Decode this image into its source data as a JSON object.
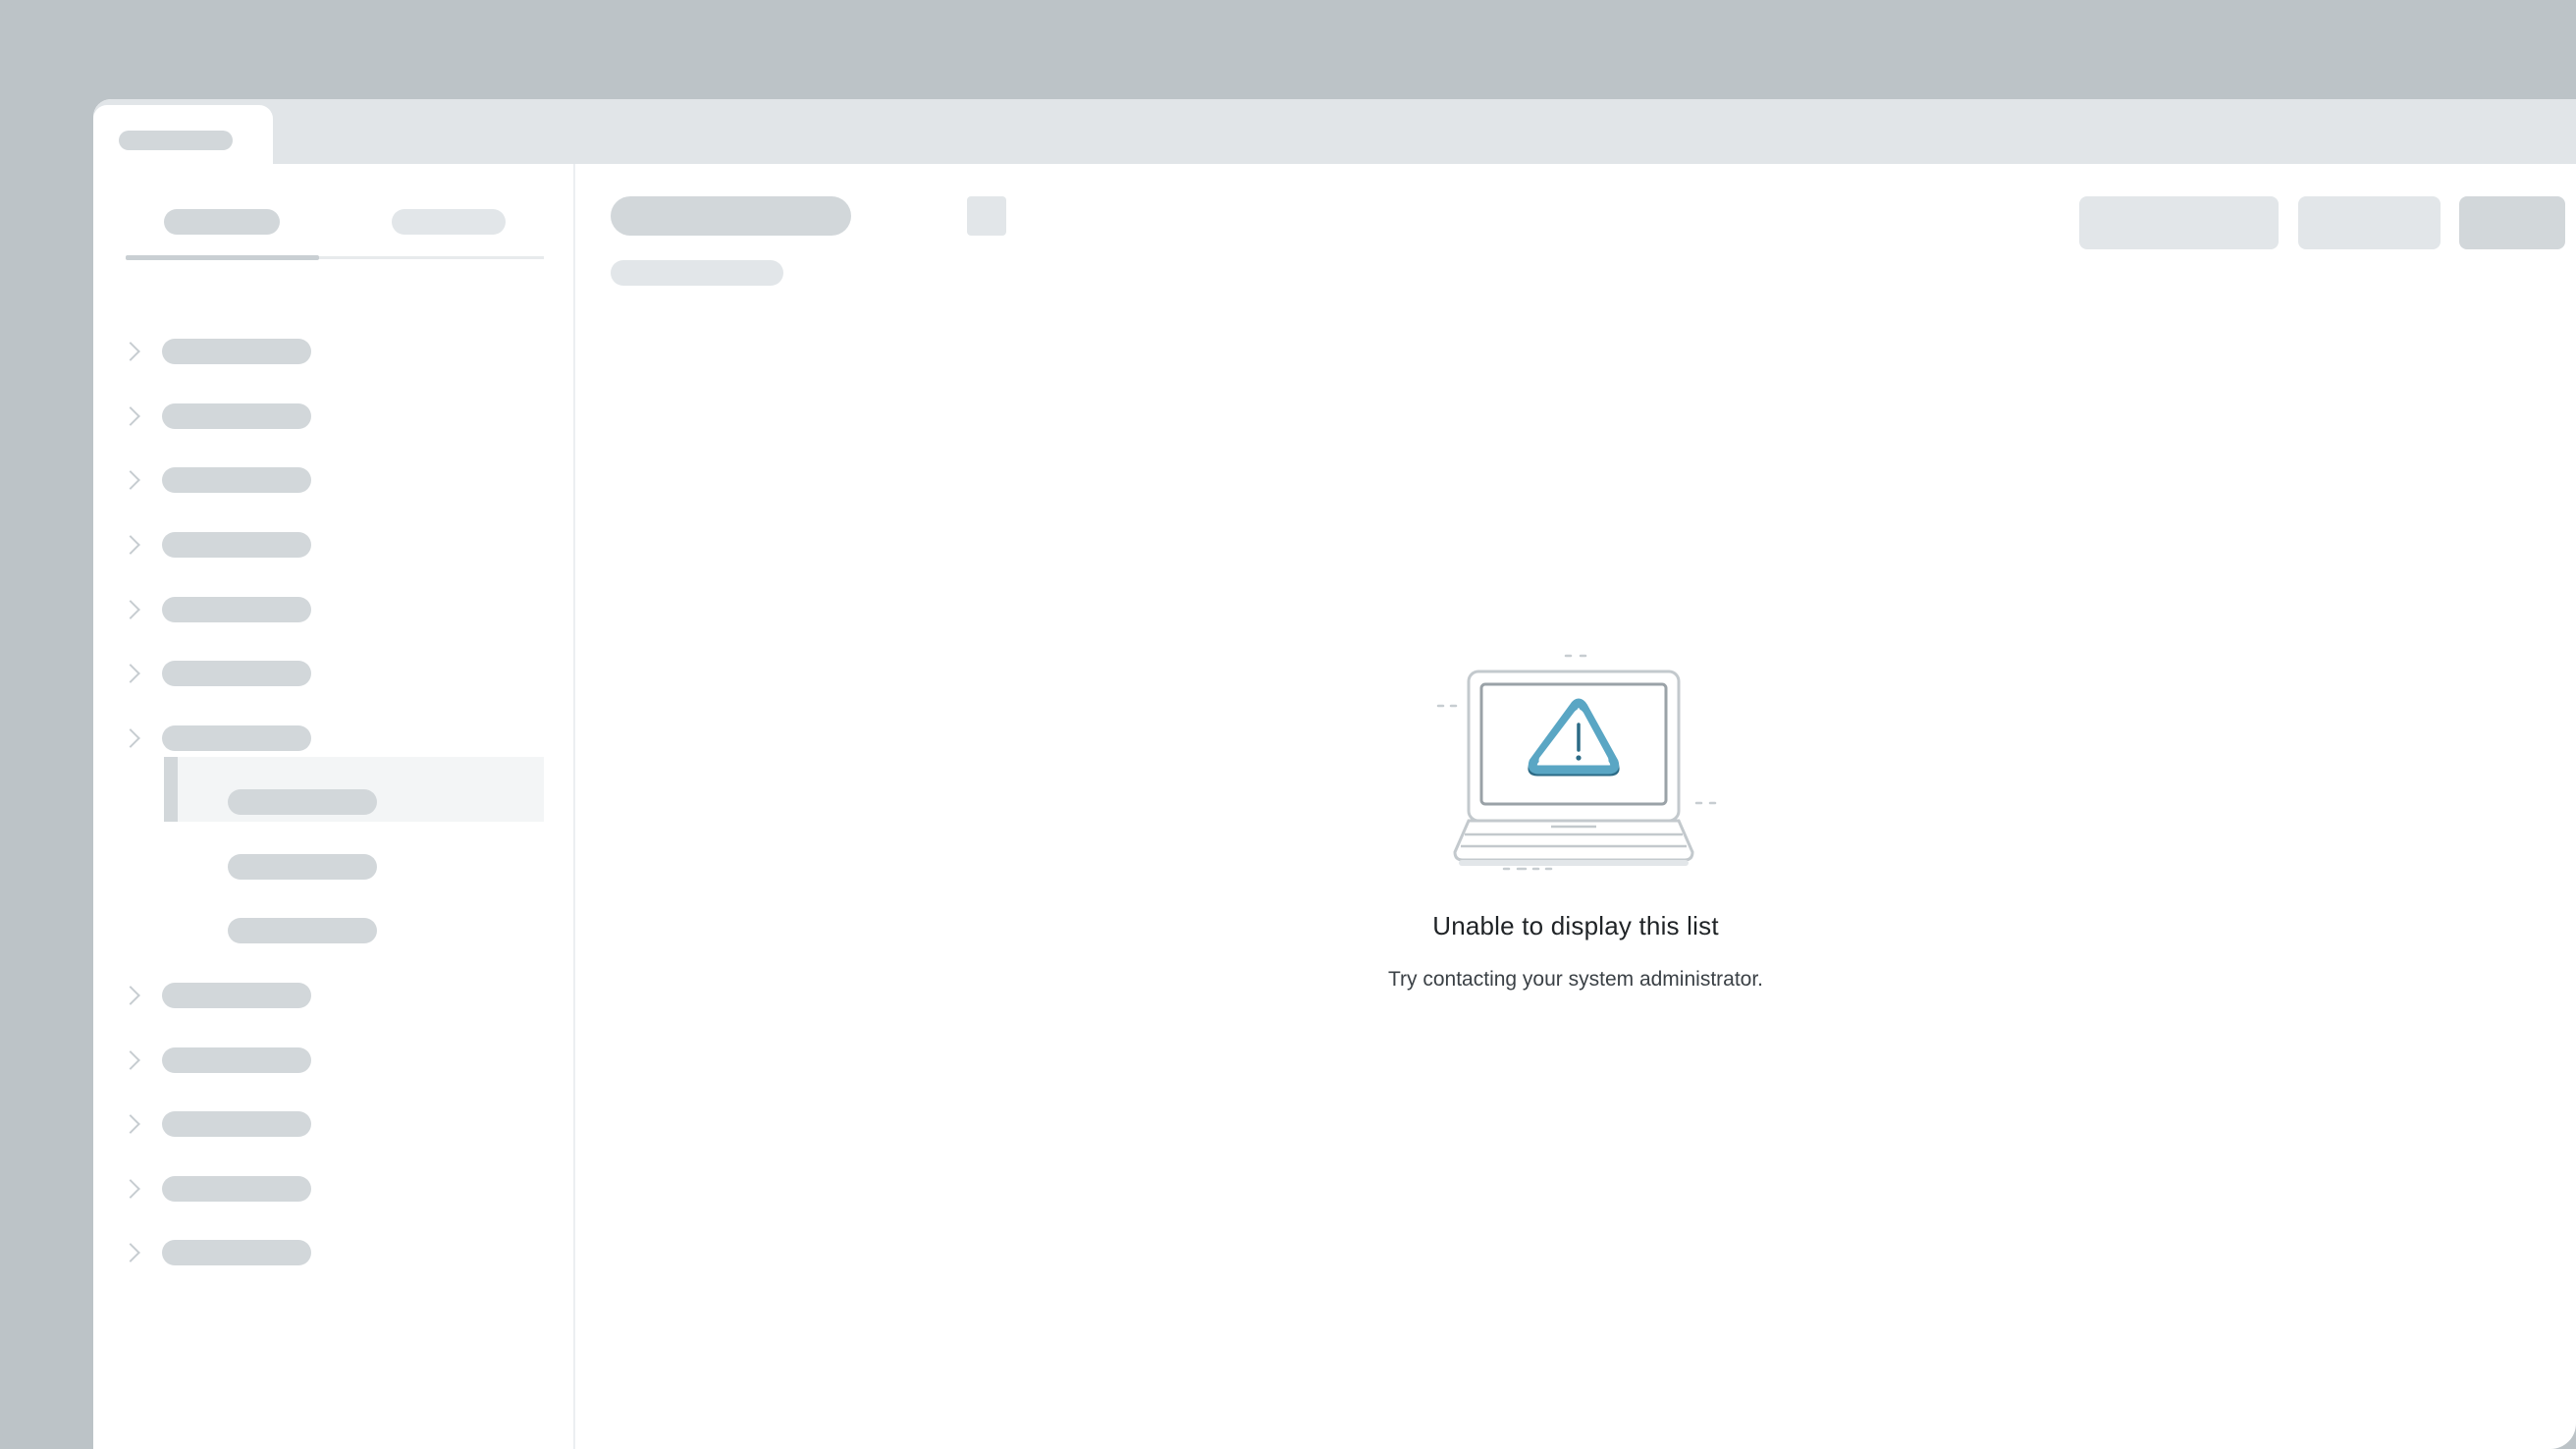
{
  "empty_state": {
    "title": "Unable to display this list",
    "message": "Try contacting your system administrator.",
    "icon": "laptop-warning-icon"
  },
  "colors": {
    "frame": "#bcc3c7",
    "skeleton": "#d2d7da",
    "skeleton_light": "#e2e6e9",
    "warning_accent": "#5aa6c4",
    "warning_dark": "#2c6b86"
  },
  "sidebar": {
    "tree": [
      {
        "expandable": true
      },
      {
        "expandable": true
      },
      {
        "expandable": true
      },
      {
        "expandable": true
      },
      {
        "expandable": true
      },
      {
        "expandable": true
      },
      {
        "expandable": true,
        "expanded": true
      },
      {
        "expandable": false
      },
      {
        "expandable": false
      },
      {
        "expandable": false
      },
      {
        "expandable": true
      },
      {
        "expandable": true
      },
      {
        "expandable": true
      },
      {
        "expandable": true
      },
      {
        "expandable": true
      }
    ]
  }
}
